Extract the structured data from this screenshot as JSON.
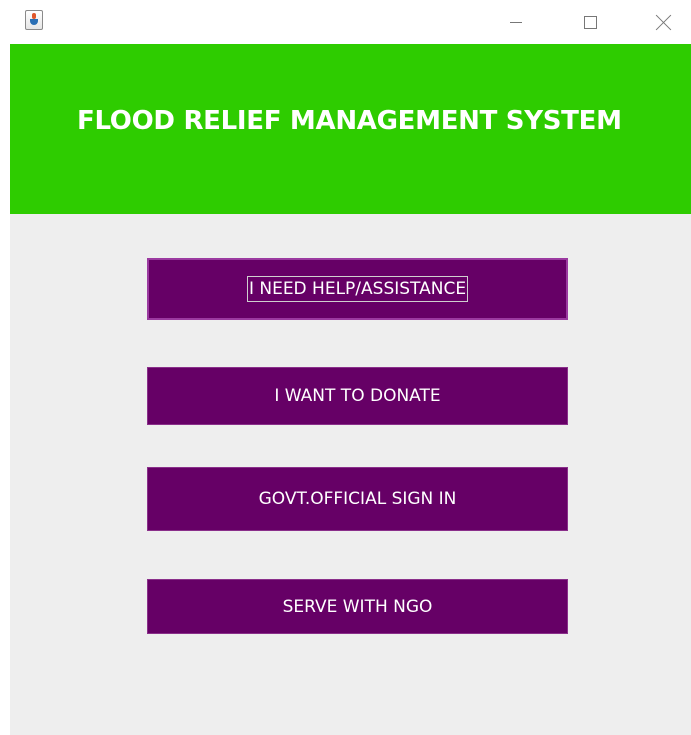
{
  "window": {
    "app_icon": "java-cup-icon",
    "controls": {
      "minimize": "minimize-icon",
      "maximize": "maximize-icon",
      "close": "close-icon"
    }
  },
  "header": {
    "title": "FLOOD RELIEF MANAGEMENT SYSTEM",
    "background_color": "#2ecc00",
    "text_color": "#ffffff"
  },
  "menu": {
    "button_color": "#660066",
    "buttons": [
      {
        "label": "I NEED HELP/ASSISTANCE",
        "focused": true
      },
      {
        "label": "I WANT TO DONATE",
        "focused": false
      },
      {
        "label": "GOVT.OFFICIAL SIGN IN",
        "focused": false
      },
      {
        "label": "SERVE WITH NGO",
        "focused": false
      }
    ]
  },
  "panel": {
    "background_color": "#eeeeee"
  }
}
